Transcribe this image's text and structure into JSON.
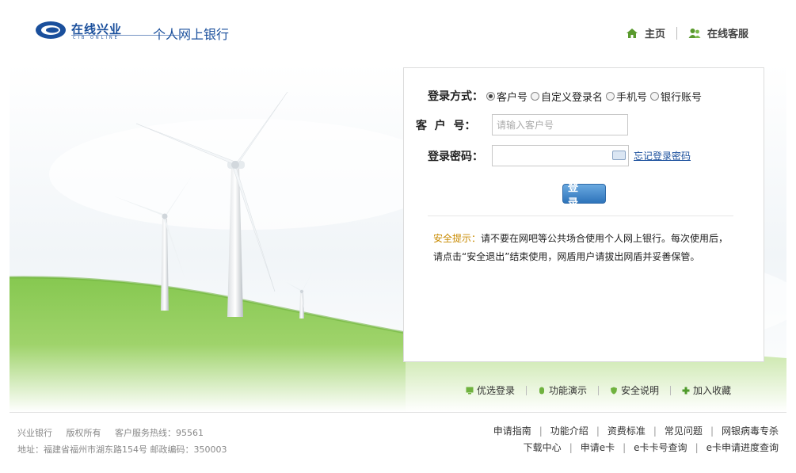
{
  "header": {
    "logo_text": "在线兴业",
    "logo_sub": "CIB ONLINE",
    "site_title": "个人网上银行",
    "nav": [
      {
        "label": "主页",
        "icon": "home-icon"
      },
      {
        "label": "在线客服",
        "icon": "customer-service-icon"
      }
    ]
  },
  "login": {
    "method_label": "登录方式：",
    "methods": [
      "客户号",
      "自定义登录名",
      "手机号",
      "银行账号"
    ],
    "selected_method": "客户号",
    "account_label": "客  户  号：",
    "account_placeholder": "请输入客户号",
    "password_label": "登录密码：",
    "forgot_label": "忘记登录密码",
    "submit_label": "登 录",
    "tip_label": "安全提示：",
    "tip_text_1": "请不要在网吧等公共场合使用个人网上银行。每次使用后，",
    "tip_text_2": "请点击“安全退出”结束使用，网盾用户请拔出网盾并妥善保管。"
  },
  "quicklinks": [
    "优选登录",
    "功能演示",
    "安全说明",
    "加入收藏"
  ],
  "footer": {
    "bank": "兴业银行",
    "copyright": "版权所有",
    "hotline": "客户服务热线：95561",
    "address": "地址：福建省福州市湖东路154号  邮政编码：350003",
    "links_row1": [
      "申请指南",
      "功能介绍",
      "资费标准",
      "常见问题",
      "网银病毒专杀"
    ],
    "links_row2": [
      "下载中心",
      "申请e卡",
      "e卡卡号查询",
      "e卡申请进度查询"
    ]
  },
  "colors": {
    "brand": "#1a4f9c",
    "grass": "#7cc34a",
    "tip_label": "#c88a00",
    "button": "#2e74bb"
  }
}
